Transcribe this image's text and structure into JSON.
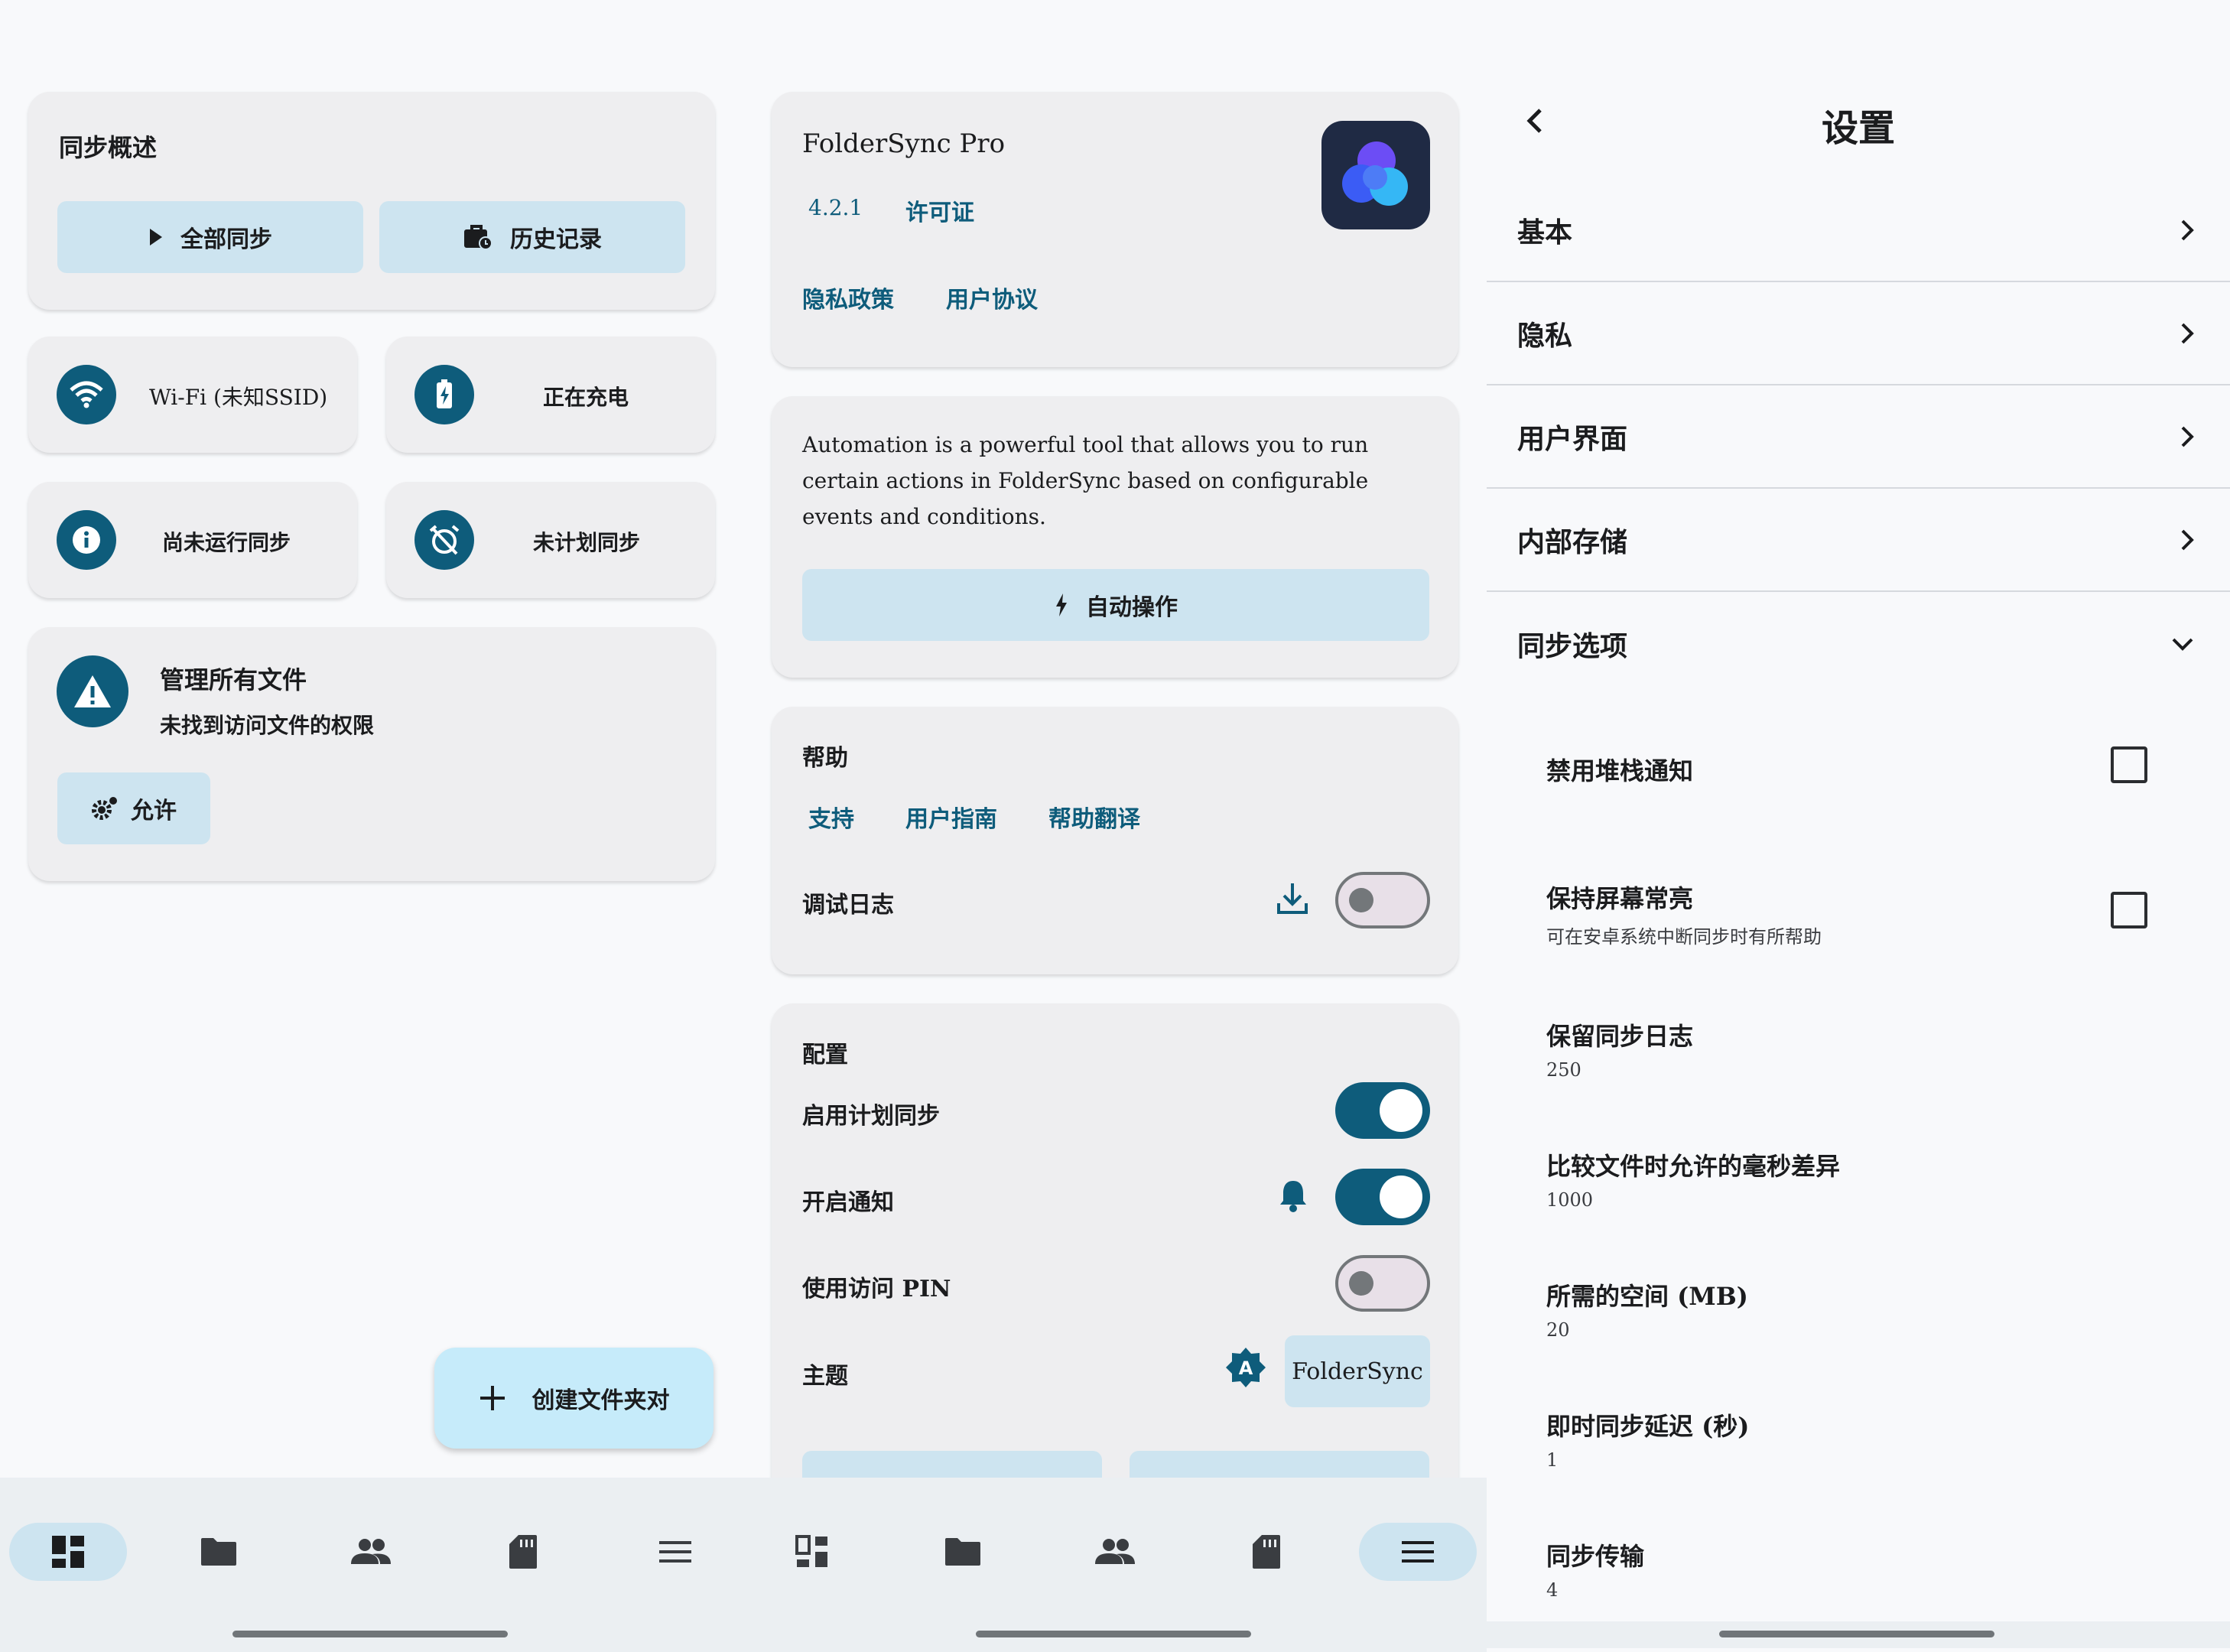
{
  "dashboard": {
    "overview_title": "同步概述",
    "sync_all_label": "全部同步",
    "history_label": "历史记录",
    "wifi_label": "Wi-Fi (未知SSID)",
    "charging_label": "正在充电",
    "not_run_label": "尚未运行同步",
    "not_scheduled_label": "未计划同步",
    "manage_files_title": "管理所有文件",
    "manage_files_subtitle": "未找到访问文件的权限",
    "allow_label": "允许",
    "fab_label": "创建文件夹对"
  },
  "about": {
    "app_name": "FolderSync Pro",
    "version": "4.2.1",
    "license_label": "许可证",
    "privacy_label": "隐私政策",
    "terms_label": "用户协议",
    "automation_text": "Automation is a powerful tool that allows you to run certain actions in FolderSync based on configurable events and conditions.",
    "automation_button": "自动操作",
    "help_title": "帮助",
    "support_label": "支持",
    "guide_label": "用户指南",
    "translate_label": "帮助翻译",
    "debug_log_label": "调试日志",
    "debug_log_on": false,
    "config_title": "配置",
    "scheduled_sync_label": "启用计划同步",
    "scheduled_sync_on": true,
    "notifications_label": "开启通知",
    "notifications_on": true,
    "pin_label": "使用访问 PIN",
    "pin_on": false,
    "theme_label": "主题",
    "theme_value": "FolderSync"
  },
  "settings": {
    "title": "设置",
    "sections": [
      "基本",
      "隐私",
      "用户界面",
      "内部存储"
    ],
    "sync_options_label": "同步选项",
    "options": [
      {
        "title": "禁用堆栈通知",
        "subtitle": "",
        "checkbox": true,
        "checked": false
      },
      {
        "title": "保持屏幕常亮",
        "subtitle": "可在安卓系统中断同步时有所帮助",
        "checkbox": true,
        "checked": false
      },
      {
        "title": "保留同步日志",
        "subtitle": "250"
      },
      {
        "title": "比较文件时允许的毫秒差异",
        "subtitle": "1000"
      },
      {
        "title": "所需的空间 (MB)",
        "subtitle": "20"
      },
      {
        "title": "即时同步延迟 (秒)",
        "subtitle": "1"
      },
      {
        "title": "同步传输",
        "subtitle": "4"
      }
    ]
  },
  "nav_items": [
    "dashboard-icon",
    "folder-icon",
    "people-icon",
    "sd-card-icon",
    "menu-icon"
  ],
  "colors": {
    "primary": "#0e5c7b",
    "tonal": "#cde4f0",
    "card": "#eeeef0",
    "fab": "#c6ebfa"
  }
}
